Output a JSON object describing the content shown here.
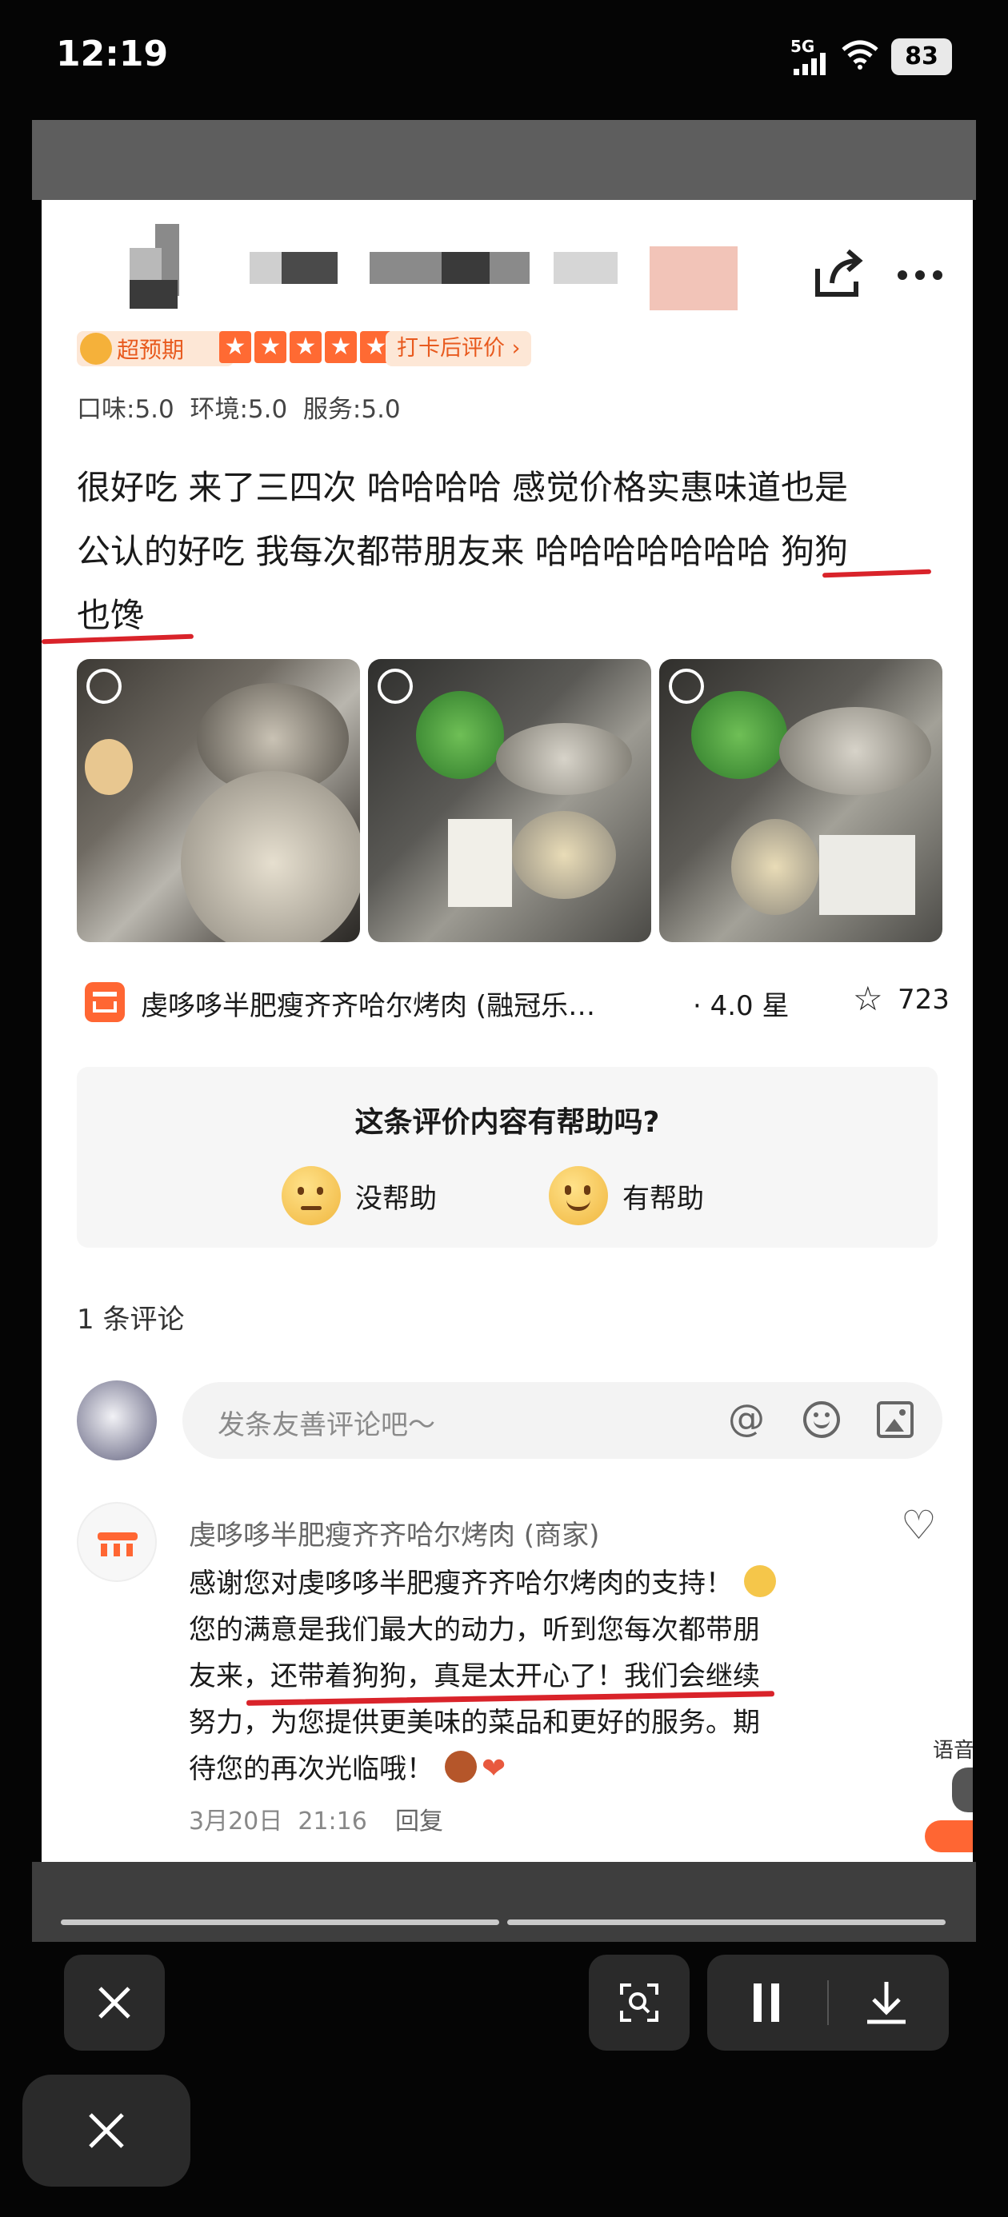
{
  "status_bar": {
    "time": "12:19",
    "network": "5G",
    "battery": "83"
  },
  "review": {
    "badge_label": "超预期",
    "checkin_label": "打卡后评价 ›",
    "scores": "口味:5.0  环境:5.0  服务:5.0",
    "text_line1": "很好吃 来了三四次 哈哈哈哈 感觉价格实惠味道也是",
    "text_line2": "公认的好吃 我每次都带朋友来 哈哈哈哈哈哈哈 狗狗",
    "text_line3": "也馋",
    "stars": 5
  },
  "shop": {
    "name": "虔哆哆半肥瘦齐齐哈尔烤肉 (融冠乐…",
    "rating": "· 4.0 星",
    "favorites": "723"
  },
  "helpful": {
    "question": "这条评价内容有帮助吗?",
    "no_label": "没帮助",
    "yes_label": "有帮助"
  },
  "comments": {
    "count_label": "1 条评论",
    "input_placeholder": "发条友善评论吧～",
    "merchant_name": "虔哆哆半肥瘦齐齐哈尔烤肉 (商家)",
    "reply_line1": "感谢您对虔哆哆半肥瘦齐齐哈尔烤肉的支持！",
    "reply_line2": "您的满意是我们最大的动力，听到您每次都带朋",
    "reply_line3": "友来，还带着狗狗，真是太开心了！我们会继续",
    "reply_line4": "努力，为您提供更美味的菜品和更好的服务。期",
    "reply_line5": "待您的再次光临哦！",
    "reply_time": "3月20日  21:16",
    "reply_action": "回复"
  },
  "side_label": "语音",
  "colors": {
    "accent": "#ff6633",
    "underline": "#d9232a",
    "star": "#ff6a33"
  }
}
